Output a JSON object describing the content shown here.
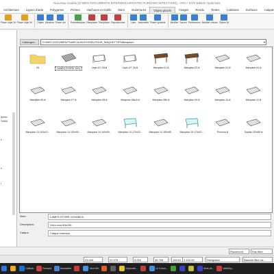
{
  "window": {
    "title": "Nouveau modèle [D:\\MES DOCUMENTS INTERNES\\ARCHITECTURE\\ARCHITECTURE] - ARC+ EVO Edition Optimisée"
  },
  "menu_tabs": [
    "Architecture",
    "Lignes d'aide",
    "Polygones",
    "Primes",
    "Hachures et motifs",
    "Murs",
    "Ouvertures",
    "Objets placés",
    "Images",
    "Rendu",
    "Textes",
    "Cotations",
    "Surfaces",
    "Calques"
  ],
  "active_tab": "Objets placés",
  "ribbon": {
    "buttons": [
      {
        "label": "Placer objet 2d",
        "color": "#e0a020"
      },
      {
        "label": "Placer objet 3d",
        "color": "#e0a020"
      },
      {
        "label": "Objets",
        "color": "#3a7fd0"
      },
      {
        "label": "Aléatoire",
        "color": "#3a7fd0"
      },
      {
        "label": "Placer sur",
        "color": "#3a7fd0"
      },
      {
        "label": "Paramétriques",
        "color": "#4aa04a"
      },
      {
        "label": "Remplacer",
        "color": "#c04040"
      },
      {
        "label": "Remplacer",
        "color": "#c04040"
      },
      {
        "label": "Repositionner",
        "color": "#c04040"
      },
      {
        "label": "Liste",
        "color": "#3a7fd0"
      },
      {
        "label": "Assembler",
        "color": "#3a7fd0"
      },
      {
        "label": "Placer symbole",
        "color": "#3a7fd0"
      },
      {
        "label": "Modifier",
        "color": "#3a7fd0"
      },
      {
        "label": "Sauver",
        "color": "#3a7fd0"
      },
      {
        "label": "Préférences",
        "color": "#3a7fd0"
      },
      {
        "label": "Modifier chemin",
        "color": "#3a7fd0"
      },
      {
        "label": "Objets 3d",
        "color": "#3a7fd0"
      }
    ]
  },
  "left_panel": {
    "lines": [
      "gneau",
      "Tocker",
      "e",
      "",
      "e",
      "r",
      ""
    ]
  },
  "catalog": {
    "button": "Catalogue...",
    "path": "D:\\MES DOCUMENTS\\ARCALIB-EVO\\3D-POUR_MAQUETTES\\Marquise\\"
  },
  "items": [
    {
      "label": "2D",
      "kind": "folder",
      "selected": false
    },
    {
      "label": "LAMES-STORE-100x",
      "kind": "louvre",
      "selected": true
    },
    {
      "label": "Leya-10°-3d.iii",
      "kind": "frame",
      "selected": false
    },
    {
      "label": "Leya-10°-3d.iii",
      "kind": "frame",
      "selected": false
    },
    {
      "label": "Marquise-01.iii",
      "kind": "brown",
      "selected": false
    },
    {
      "label": "Marquise-02.iii",
      "kind": "brown",
      "selected": false
    },
    {
      "label": "Marquise-03.iii",
      "kind": "canopy",
      "selected": false
    },
    {
      "label": "Marquise-04.iii",
      "kind": "canopy",
      "selected": false
    },
    {
      "label": "Marquise-05.iii",
      "kind": "canopy",
      "selected": false
    },
    {
      "label": "Marquise-07.iii",
      "kind": "canopy",
      "selected": false
    },
    {
      "label": "Marquise-08.iii",
      "kind": "canopy",
      "selected": false
    },
    {
      "label": "Marquise-08a.5.iii",
      "kind": "canopy",
      "selected": false
    },
    {
      "label": "Marquise-08b.iii",
      "kind": "canopy",
      "selected": false
    },
    {
      "label": "Marquise-09.iii",
      "kind": "canopy",
      "selected": false
    },
    {
      "label": "Marquise-10.iii",
      "kind": "canopy",
      "selected": false
    },
    {
      "label": "Marquise-11.iii",
      "kind": "canopy",
      "selected": false
    },
    {
      "label": "Marquise-13-140x12...",
      "kind": "canopy",
      "selected": false
    },
    {
      "label": "Marquise-14-120x90...",
      "kind": "canopy",
      "selected": false
    },
    {
      "label": "Marquise-14-140x99...",
      "kind": "canopy",
      "selected": false
    },
    {
      "label": "Marquise-14-170x15...",
      "kind": "glass",
      "selected": false
    },
    {
      "label": "Marquise-14-180x95...",
      "kind": "canopy",
      "selected": false
    },
    {
      "label": "Marquise-15-170x10...",
      "kind": "glass",
      "selected": false
    },
    {
      "label": "Pomona.iii",
      "kind": "canopy",
      "selected": false
    },
    {
      "label": "Sophia-215x80.iii",
      "kind": "canopy",
      "selected": false
    }
  ],
  "fields": {
    "name_label": "Nom:",
    "name_value": "LAMES-STORE-100x080.iii",
    "desc_label": "Description:",
    "desc_value": "Hors tous 80x230",
    "layer_label": "Calque:",
    "layer_value": "Calque commun"
  },
  "status": {
    "placement_label": "Placement",
    "filter_label": "Pas filtré",
    "x": "23.003",
    "y": "22.378",
    "z": "0.000",
    "length": "36.765",
    "angle": "145.01",
    "scale": "1:100.00",
    "mode": "Navigation",
    "filter_btn": "Bascule filtre ca..."
  },
  "taskbar": [
    {
      "label": "",
      "color": "#2d7ad6"
    },
    {
      "label": "",
      "color": "#e8b020"
    },
    {
      "label": "Outlook",
      "color": "#1a73c8"
    },
    {
      "label": "Forward",
      "color": "#d04040"
    },
    {
      "label": "Newsletter",
      "color": "#5080d0"
    },
    {
      "label": "",
      "color": "#c04040"
    },
    {
      "label": "Vers Win",
      "color": "#4a90e0"
    },
    {
      "label": "",
      "color": "#e06020"
    },
    {
      "label": "",
      "color": "#606060"
    },
    {
      "label": "Explorate...",
      "color": "#e8c040"
    },
    {
      "label": "",
      "color": "#c04040"
    },
    {
      "label": "Le Colom...",
      "color": "#4a90e0"
    },
    {
      "label": "",
      "color": "#40a040"
    },
    {
      "label": "",
      "color": "#4040c0"
    },
    {
      "label": "",
      "color": "#c0c040"
    },
    {
      "label": "Mots de...",
      "color": "#4040c0"
    },
    {
      "label": "WebExp...",
      "color": "#c04040"
    }
  ]
}
